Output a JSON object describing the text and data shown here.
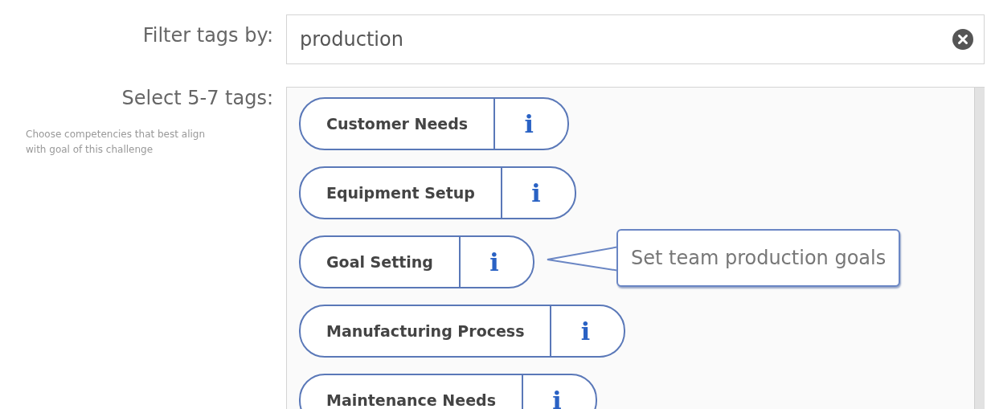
{
  "filter": {
    "label": "Filter tags by:",
    "value": "production"
  },
  "tags_section": {
    "label": "Select 5-7 tags:",
    "hint": "Choose competencies that best align with goal of this challenge",
    "tags": [
      {
        "label": "Customer Needs",
        "info": "i"
      },
      {
        "label": "Equipment Setup",
        "info": "i"
      },
      {
        "label": "Goal Setting",
        "info": "i",
        "tooltip": "Set team production goals"
      },
      {
        "label": "Manufacturing Process",
        "info": "i"
      },
      {
        "label": "Maintenance Needs",
        "info": "i"
      }
    ]
  }
}
